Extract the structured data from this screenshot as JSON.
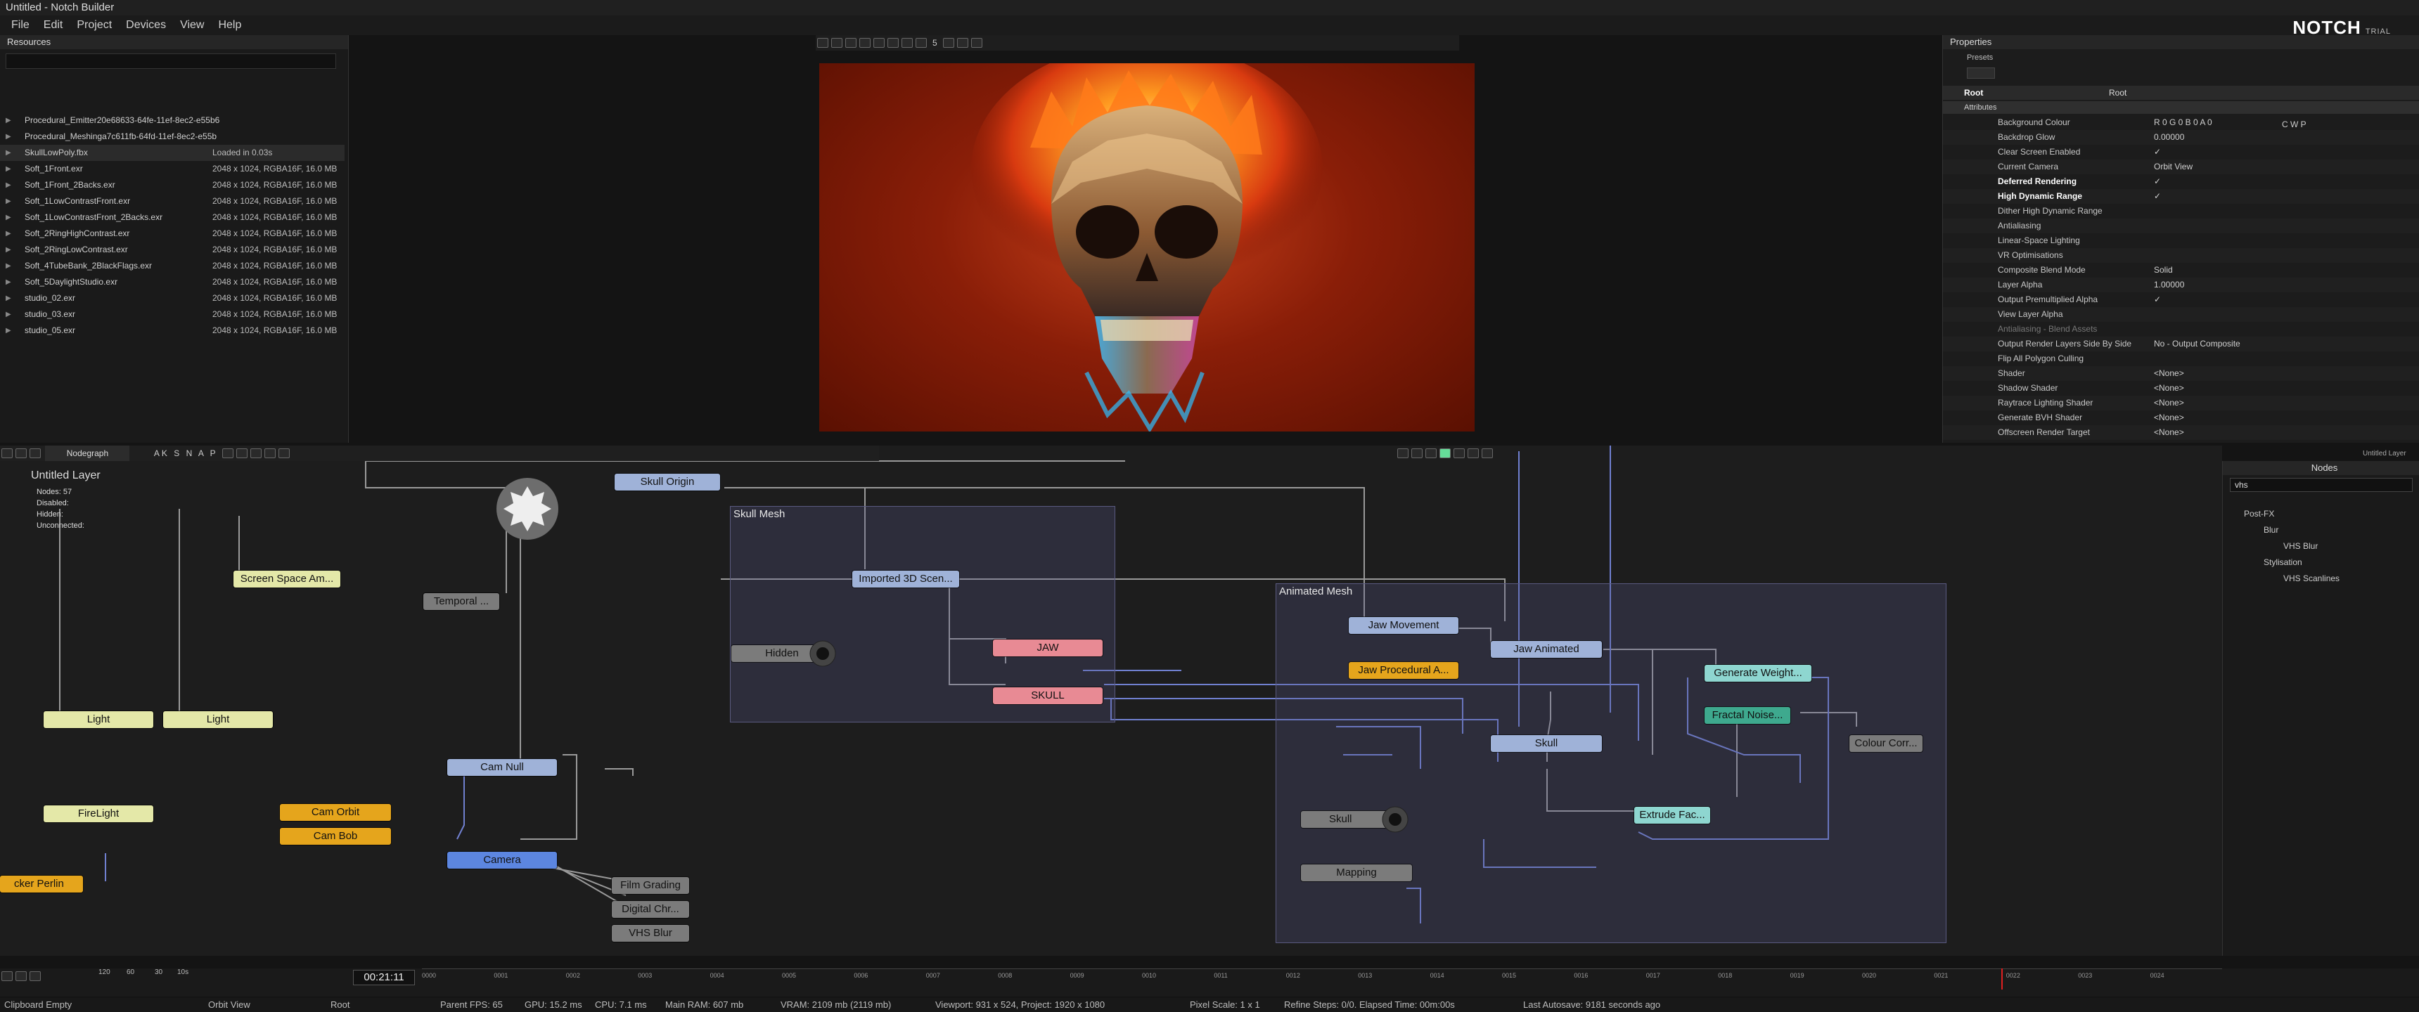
{
  "window": {
    "title": "Untitled - Notch Builder"
  },
  "menu": [
    "File",
    "Edit",
    "Project",
    "Devices",
    "View",
    "Help"
  ],
  "logo": {
    "text": "NOTCH",
    "badge": "TRIAL"
  },
  "resources": {
    "header": "Resources",
    "items": [
      {
        "name": "Procedural_Emitter20e68633-64fe-11ef-8ec2-e55b6",
        "info": ""
      },
      {
        "name": "Procedural_Meshinga7c611fb-64fd-11ef-8ec2-e55b",
        "info": ""
      },
      {
        "name": "SkullLowPoly.fbx",
        "info": "Loaded in 0.03s"
      },
      {
        "name": "Soft_1Front.exr",
        "info": "2048 x 1024, RGBA16F, 16.0 MB"
      },
      {
        "name": "Soft_1Front_2Backs.exr",
        "info": "2048 x 1024, RGBA16F, 16.0 MB"
      },
      {
        "name": "Soft_1LowContrastFront.exr",
        "info": "2048 x 1024, RGBA16F, 16.0 MB"
      },
      {
        "name": "Soft_1LowContrastFront_2Backs.exr",
        "info": "2048 x 1024, RGBA16F, 16.0 MB"
      },
      {
        "name": "Soft_2RingHighContrast.exr",
        "info": "2048 x 1024, RGBA16F, 16.0 MB"
      },
      {
        "name": "Soft_2RingLowContrast.exr",
        "info": "2048 x 1024, RGBA16F, 16.0 MB"
      },
      {
        "name": "Soft_4TubeBank_2BlackFlags.exr",
        "info": "2048 x 1024, RGBA16F, 16.0 MB"
      },
      {
        "name": "Soft_5DaylightStudio.exr",
        "info": "2048 x 1024, RGBA16F, 16.0 MB"
      },
      {
        "name": "studio_02.exr",
        "info": "2048 x 1024, RGBA16F, 16.0 MB"
      },
      {
        "name": "studio_03.exr",
        "info": "2048 x 1024, RGBA16F, 16.0 MB"
      },
      {
        "name": "studio_05.exr",
        "info": "2048 x 1024, RGBA16F, 16.0 MB"
      }
    ]
  },
  "viewport_toolbar": {
    "frame": "5"
  },
  "properties": {
    "header": "Properties",
    "presets": "Presets",
    "root_label": "Root",
    "root_value": "Root",
    "section": "Attributes",
    "rows": [
      {
        "label": "Background Colour",
        "value": "R 0 G 0 B 0 A 0",
        "style": ""
      },
      {
        "label": "Backdrop Glow",
        "value": "0.00000",
        "style": ""
      },
      {
        "label": "Clear Screen Enabled",
        "value": "✓",
        "style": ""
      },
      {
        "label": "Current Camera",
        "value": "Orbit View",
        "style": ""
      },
      {
        "label": "Deferred Rendering",
        "value": "✓",
        "style": "bold"
      },
      {
        "label": "High Dynamic Range",
        "value": "✓",
        "style": "bold"
      },
      {
        "label": "Dither High Dynamic Range",
        "value": "",
        "style": ""
      },
      {
        "label": "Antialiasing",
        "value": "",
        "style": ""
      },
      {
        "label": "Linear-Space Lighting",
        "value": "",
        "style": ""
      },
      {
        "label": "VR Optimisations",
        "value": "",
        "style": ""
      },
      {
        "label": "Composite Blend Mode",
        "value": "Solid",
        "style": ""
      },
      {
        "label": "Layer Alpha",
        "value": "1.00000",
        "style": ""
      },
      {
        "label": "Output Premultiplied Alpha",
        "value": "✓",
        "style": ""
      },
      {
        "label": "View Layer Alpha",
        "value": "",
        "style": ""
      },
      {
        "label": "Antialiasing - Blend Assets",
        "value": "",
        "style": "dim"
      },
      {
        "label": "Output Render Layers Side By Side",
        "value": "No - Output Composite",
        "style": ""
      },
      {
        "label": "Flip All Polygon Culling",
        "value": "",
        "style": ""
      },
      {
        "label": "Shader",
        "value": "<None>",
        "style": ""
      },
      {
        "label": "Shadow Shader",
        "value": "<None>",
        "style": ""
      },
      {
        "label": "Raytrace Lighting Shader",
        "value": "<None>",
        "style": ""
      },
      {
        "label": "Generate BVH Shader",
        "value": "<None>",
        "style": ""
      },
      {
        "label": "Offscreen Render Target",
        "value": "<None>",
        "style": ""
      }
    ],
    "colour_channels": "C W P",
    "status": "Untitled Layer"
  },
  "nodegraph": {
    "tab": "Nodegraph",
    "toolbar_letters": "AK S N A P",
    "layer_title": "Untitled  Layer",
    "stats": [
      "Nodes: 57",
      "Disabled:",
      "Hidden:",
      "Unconnected:"
    ],
    "groups": {
      "skull_mesh": "Skull  Mesh",
      "animated_mesh": "Animated  Mesh"
    },
    "nodes": {
      "skull_origin": "Skull  Origin",
      "screen_space": "Screen  Space  Am...",
      "temporal": "Temporal  ...",
      "imported_3d": "Imported  3D  Scen...",
      "hidden": "Hidden",
      "jaw": "JAW",
      "skull_red": "SKULL",
      "light1": "Light",
      "light2": "Light",
      "firelight": "FireLight",
      "flicker": "cker  Perlin",
      "cam_null": "Cam  Null",
      "cam_orbit": "Cam  Orbit",
      "cam_bob": "Cam  Bob",
      "camera": "Camera",
      "film_grading": "Film  Grading",
      "digital_chr": "Digital  Chr...",
      "vhs_blur": "VHS  Blur",
      "jaw_movement": "Jaw  Movement",
      "jaw_procedural": "Jaw  Procedural  A...",
      "jaw_animated": "Jaw  Animated",
      "generate_weight": "Generate  Weight...",
      "fractal_noise": "Fractal  Noise...",
      "colour_corr": "Colour  Corr...",
      "skull_anim": "Skull",
      "extrude": "Extrude  Fac...",
      "skull_gray": "Skull",
      "mapping": "Mapping"
    }
  },
  "nodes_panel": {
    "header": "Nodes",
    "search": "vhs",
    "tree": [
      {
        "label": "Post-FX",
        "depth": 0
      },
      {
        "label": "Blur",
        "depth": 1
      },
      {
        "label": "VHS Blur",
        "depth": 2
      },
      {
        "label": "Stylisation",
        "depth": 1
      },
      {
        "label": "VHS Scanlines",
        "depth": 2
      }
    ]
  },
  "timeline": {
    "time": "00:21:11",
    "ticks": [
      "0000",
      "0001",
      "0002",
      "0003",
      "0004",
      "0005",
      "0006",
      "0007",
      "0008",
      "0009",
      "0010",
      "0011",
      "0012",
      "0013",
      "0014",
      "0015",
      "0016",
      "0017",
      "0018",
      "0019",
      "0020",
      "0021",
      "0022",
      "0023",
      "0024"
    ],
    "transport": [
      "120",
      "60",
      "30",
      "10s"
    ]
  },
  "status": {
    "clipboard": "Clipboard Empty",
    "camera": "Orbit View",
    "root": "Root",
    "parent": "Parent  FPS: 65",
    "gpu": "GPU: 15.2 ms",
    "cpu": "CPU: 7.1 ms",
    "ram": "Main RAM: 607 mb",
    "vram": "VRAM: 2109 mb (2119 mb)",
    "viewport": "Viewport: 931 x 524, Project: 1920 x 1080",
    "pixel_scale": "Pixel Scale: 1 x 1",
    "refine": "Refine Steps: 0/0. Elapsed Time: 00m:00s",
    "autosave": "Last Autosave: 9181 seconds ago"
  },
  "colors": {
    "accent_red": "#e02020",
    "node_blue": "#9fb2d8",
    "node_yellow": "#e5a51c"
  }
}
